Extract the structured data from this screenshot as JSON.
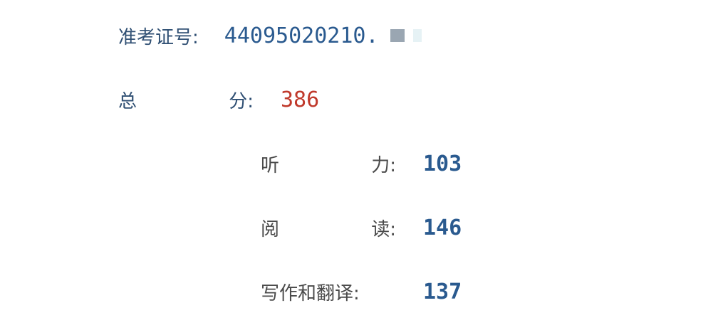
{
  "exam_number": {
    "label": "准考证号:",
    "value": "44095020210."
  },
  "total": {
    "label_left": "总",
    "label_right": "分:",
    "value": "386"
  },
  "sections": [
    {
      "label_left": "听",
      "label_right": "力:",
      "value": "103"
    },
    {
      "label_left": "阅",
      "label_right": "读:",
      "value": "146"
    },
    {
      "label_full": "写作和翻译:",
      "value": "137"
    }
  ],
  "colors": {
    "label": "#2f4f73",
    "total_value": "#c0392b",
    "section_value": "#2a5a8f"
  }
}
